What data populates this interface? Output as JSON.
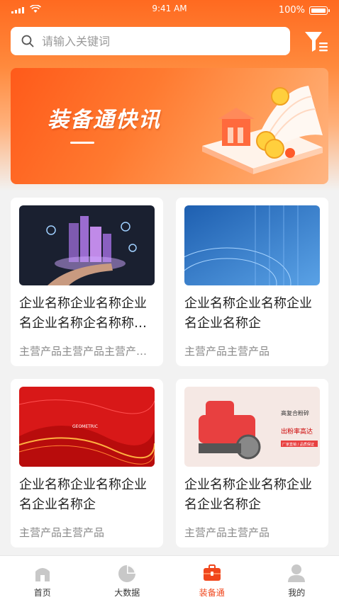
{
  "status_bar": {
    "time": "9:41 AM",
    "battery": "100%"
  },
  "search": {
    "placeholder": "请输入关键词"
  },
  "banner": {
    "title": "装备通快讯"
  },
  "cards": [
    {
      "name": "企业名称企业名称企业名企业名称企名称称企业名称",
      "product": "主营产品主营产品主营产品主营"
    },
    {
      "name": "企业名称企业名称企业名企业名称企",
      "product": "主营产品主营产品"
    },
    {
      "name": "企业名称企业名称企业名企业名称企",
      "product": "主营产品主营产品"
    },
    {
      "name": "企业名称企业名称企业名企业名称企",
      "product": "主营产品主营产品"
    }
  ],
  "card3_thumb_text": {
    "line1": "GEOMETRIC"
  },
  "card4_thumb_text": {
    "line1": "高复合粉碎",
    "line2": "出粉率高达",
    "line3": "厂家直销 / 品质保证"
  },
  "tabbar": {
    "items": [
      {
        "label": "首页",
        "icon": "home-icon"
      },
      {
        "label": "大数据",
        "icon": "pie-chart-icon"
      },
      {
        "label": "装备通",
        "icon": "toolbox-icon"
      },
      {
        "label": "我的",
        "icon": "user-icon"
      }
    ],
    "active_index": 2
  },
  "colors": {
    "accent": "#f0461c",
    "brand_orange": "#ff6a20"
  }
}
